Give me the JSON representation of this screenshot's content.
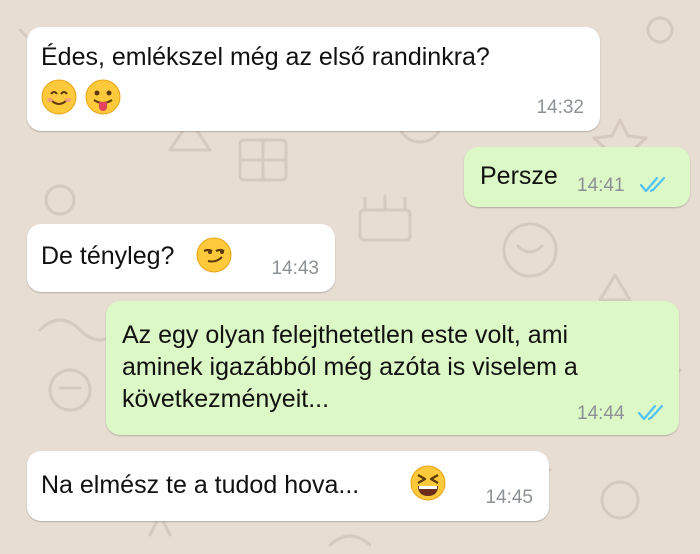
{
  "chat": {
    "messages": [
      {
        "direction": "incoming",
        "text": "Édes, emlékszel még az első randinkra?",
        "emojis": [
          "smiling-face",
          "face-with-tongue"
        ],
        "time": "14:32"
      },
      {
        "direction": "outgoing",
        "text": "Persze",
        "time": "14:41",
        "status": "read"
      },
      {
        "direction": "incoming",
        "text": "De tényleg?",
        "emojis": [
          "smirking-face"
        ],
        "time": "14:43"
      },
      {
        "direction": "outgoing",
        "lines": [
          "Az egy olyan felejthetetlen este volt, ami",
          "aminek igazábból még azóta is viselem a",
          "következményeit..."
        ],
        "time": "14:44",
        "status": "read"
      },
      {
        "direction": "incoming",
        "text": "Na elmész te a tudod hova...",
        "emojis": [
          "grinning-squinting-face"
        ],
        "time": "14:45"
      }
    ]
  },
  "colors": {
    "background": "#e7ddd3",
    "incoming_bubble": "#ffffff",
    "outgoing_bubble": "#dcf8c6",
    "read_ticks": "#4fc3f7",
    "timestamp": "#8c9196"
  }
}
